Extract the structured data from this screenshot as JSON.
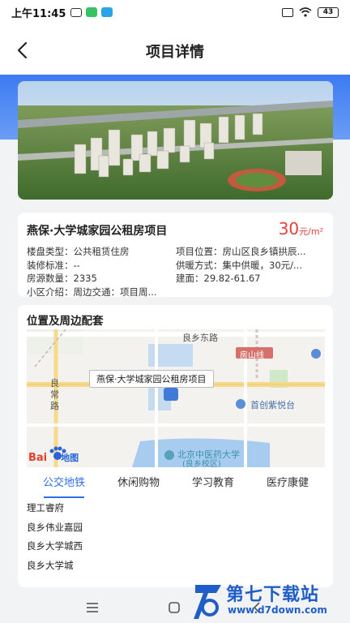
{
  "status_bar": {
    "time": "上午11:45",
    "battery": "43"
  },
  "header": {
    "title": "项目详情",
    "back_icon": "chevron-left-icon"
  },
  "project": {
    "name": "燕保·大学城家园公租房项目",
    "price_value": "30",
    "price_unit": "元/m²",
    "info": [
      {
        "label": "楼盘类型：",
        "value": "公共租赁住房",
        "label2": "项目位置：",
        "value2": "房山区良乡镇拱辰..."
      },
      {
        "label": "装修标准：",
        "value": "--",
        "label2": "供暖方式：",
        "value2": "集中供暖，30元/..."
      },
      {
        "label": "房源数量：",
        "value": "2335",
        "label2": "建面：",
        "value2": "29.82-61.67"
      },
      {
        "label": "小区介绍：",
        "value": "周边交通：项目周...",
        "label2": "",
        "value2": ""
      }
    ]
  },
  "location": {
    "title": "位置及周边配套",
    "map_label": "燕保·大学城家园公租房项目",
    "map_texts": {
      "road1": "良乡东路",
      "road2_a": "良",
      "road2_b": "常",
      "road2_c": "路",
      "line": "房山线",
      "poi1": "首创紫悦台",
      "poi2": "北京中医药大学",
      "poi2_sub": "(良乡校区)",
      "logo_left": "Bai",
      "logo_right": "地图"
    },
    "tabs": [
      "公交地铁",
      "休闲购物",
      "学习教育",
      "医疗康健"
    ],
    "active_tab": 0,
    "stops": [
      "理工睿府",
      "良乡伟业嘉园",
      "良乡大学城西",
      "良乡大学城"
    ]
  },
  "watermark": {
    "text": "第七下载站",
    "url": "www.d7down.com"
  },
  "colors": {
    "accent": "#2f6fe8",
    "price": "#e5403d",
    "band": "#3d7bf3"
  }
}
